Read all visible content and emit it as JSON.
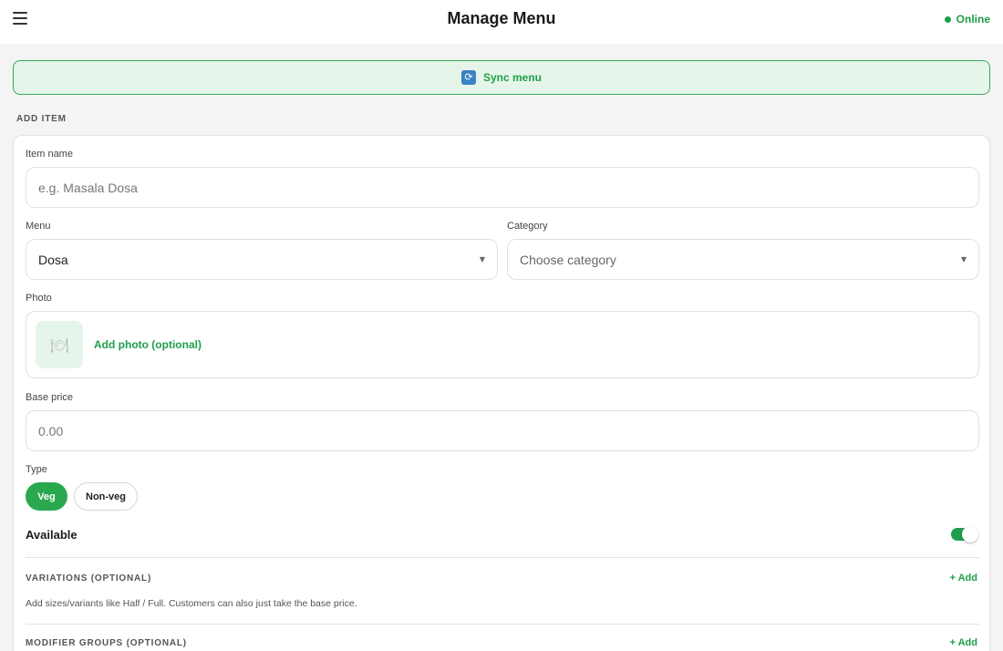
{
  "header": {
    "title": "Manage Menu",
    "status": "Online"
  },
  "sync": {
    "label": "Sync menu",
    "icon": "sync-icon"
  },
  "form": {
    "section_label": "ADD ITEM",
    "item_name": {
      "label": "Item name",
      "placeholder": "e.g. Masala Dosa",
      "value": ""
    },
    "menu": {
      "label": "Menu",
      "value": "Dosa"
    },
    "category": {
      "label": "Category",
      "placeholder": "Choose category"
    },
    "photo": {
      "label": "Photo",
      "add_label": "Add photo (optional)"
    },
    "base_price": {
      "label": "Base price",
      "placeholder": "0.00",
      "value": ""
    },
    "type": {
      "label": "Type",
      "options": [
        "Veg",
        "Non-veg"
      ],
      "selected": "Veg"
    },
    "available": {
      "label": "Available",
      "on": true
    },
    "variations": {
      "title": "VARIATIONS (OPTIONAL)",
      "add_label": "+ Add",
      "hint": "Add sizes/variants like Half / Full. Customers can also just take the base price."
    },
    "modifier_groups": {
      "title": "MODIFIER GROUPS (OPTIONAL)",
      "add_label": "+ Add"
    }
  },
  "colors": {
    "accent": "#1e9e4a",
    "accent_light": "#e6f5e9",
    "veg_chip": "#2aa84f"
  }
}
